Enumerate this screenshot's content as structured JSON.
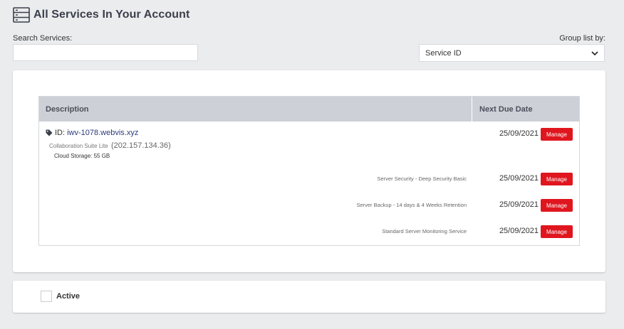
{
  "header": {
    "title": "All Services In Your Account"
  },
  "search": {
    "label": "Search Services:",
    "value": "",
    "placeholder": ""
  },
  "group_by": {
    "label": "Group list by:",
    "selected": "Service ID"
  },
  "table": {
    "columns": [
      "Description",
      "Next Due Date"
    ],
    "service": {
      "id_label": "ID:",
      "id": "iwv-1078.webvis.xyz",
      "plan": "Collaboration Suite Lite",
      "ip": "(202.157.134.36)",
      "storage": "Cloud Storage: 55 GB",
      "due": "25/09/2021",
      "action": "Manage"
    },
    "addons": [
      {
        "description": "Server Security - Deep Security Basic",
        "due": "25/09/2021",
        "action": "Manage"
      },
      {
        "description": "Server Backup - 14 days & 4 Weeks Retention",
        "due": "25/09/2021",
        "action": "Manage"
      },
      {
        "description": "Standard Server Monitoring Service",
        "due": "25/09/2021",
        "action": "Manage"
      }
    ]
  },
  "filter": {
    "active_label": "Active"
  },
  "colors": {
    "accent": "#e0161f",
    "link": "#2a3a7c",
    "header_bg": "#cdd0d6",
    "page_bg": "#ebecee"
  }
}
